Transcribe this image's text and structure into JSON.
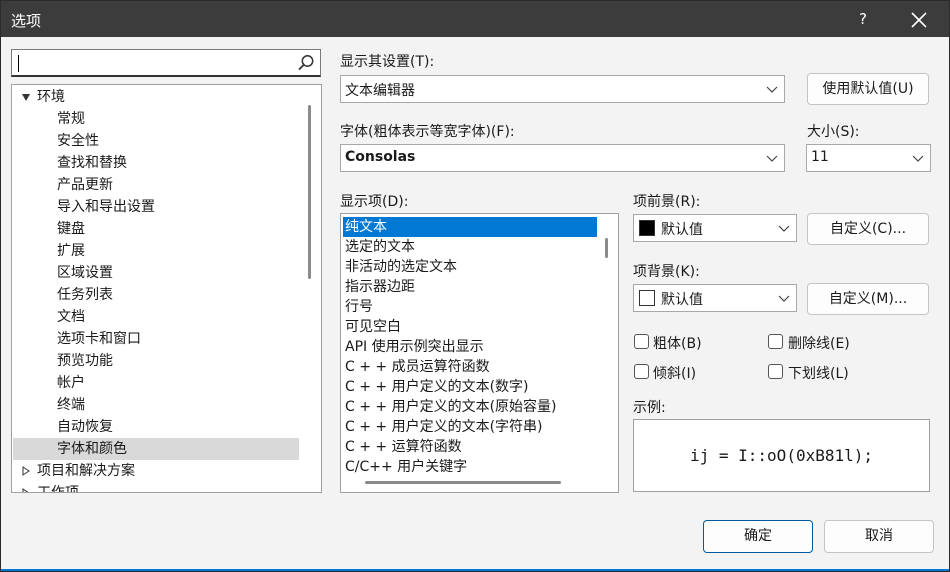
{
  "window": {
    "title": "选项",
    "help_label": "?"
  },
  "search": {
    "value": "",
    "placeholder": ""
  },
  "tree": {
    "items": [
      {
        "label": "环境",
        "level": 0,
        "expanded": true
      },
      {
        "label": "常规",
        "level": 1
      },
      {
        "label": "安全性",
        "level": 1
      },
      {
        "label": "查找和替换",
        "level": 1
      },
      {
        "label": "产品更新",
        "level": 1
      },
      {
        "label": "导入和导出设置",
        "level": 1
      },
      {
        "label": "键盘",
        "level": 1
      },
      {
        "label": "扩展",
        "level": 1
      },
      {
        "label": "区域设置",
        "level": 1
      },
      {
        "label": "任务列表",
        "level": 1
      },
      {
        "label": "文档",
        "level": 1
      },
      {
        "label": "选项卡和窗口",
        "level": 1
      },
      {
        "label": "预览功能",
        "level": 1
      },
      {
        "label": "帐户",
        "level": 1
      },
      {
        "label": "终端",
        "level": 1
      },
      {
        "label": "自动恢复",
        "level": 1
      },
      {
        "label": "字体和颜色",
        "level": 1,
        "selected": true
      },
      {
        "label": "项目和解决方案",
        "level": 0,
        "expanded": false
      },
      {
        "label": "工作项",
        "level": 0,
        "expanded": false
      }
    ]
  },
  "settings": {
    "show_settings_label": "显示其设置(T):",
    "show_settings_value": "文本编辑器",
    "use_defaults_label": "使用默认值(U)",
    "font_label": "字体(粗体表示等宽字体)(F):",
    "font_value": "Consolas",
    "size_label": "大小(S):",
    "size_value": "11",
    "display_items_label": "显示项(D):",
    "display_items": [
      "纯文本",
      "选定的文本",
      "非活动的选定文本",
      "指示器边距",
      "行号",
      "可见空白",
      "API 使用示例突出显示",
      "C + + 成员运算符函数",
      "C + + 用户定义的文本(数字)",
      "C + + 用户定义的文本(原始容量)",
      "C + + 用户定义的文本(字符串)",
      "C + + 运算符函数",
      "C/C++ 用户关键字"
    ],
    "selected_item": "纯文本",
    "foreground_label": "项前景(R):",
    "foreground_value": "默认值",
    "foreground_color": "#000000",
    "customize_fg_label": "自定义(C)...",
    "background_label": "项背景(K):",
    "background_value": "默认值",
    "background_color": "#ffffff",
    "customize_bg_label": "自定义(M)...",
    "bold_label": "粗体(B)",
    "strike_label": "删除线(E)",
    "italic_label": "倾斜(I)",
    "underline_label": "下划线(L)",
    "sample_label": "示例:",
    "sample_text": "ij = I::oO(0xB81l);"
  },
  "buttons": {
    "ok_label": "确定",
    "cancel_label": "取消"
  },
  "colors": {
    "accent": "#0078d4",
    "titlebar": "#3c3c3c",
    "selection": "#0078d4",
    "tree_selection": "#d9d9d9"
  }
}
